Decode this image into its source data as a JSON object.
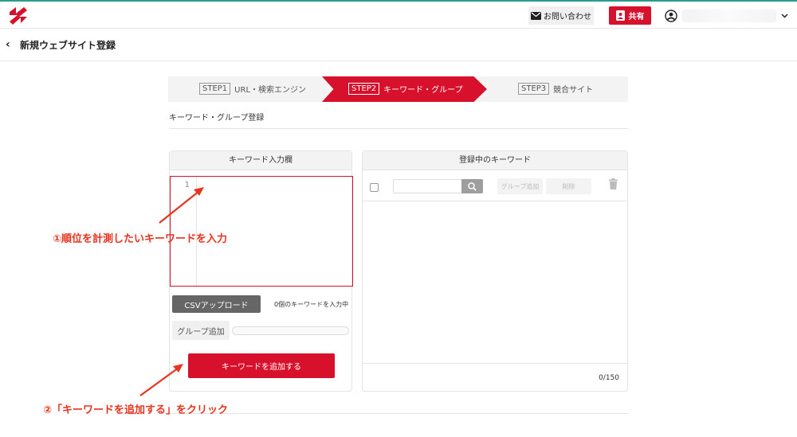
{
  "header": {
    "contact_label": "お問い合わせ",
    "share_label": "共有"
  },
  "page": {
    "back_icon": "chevron-left-icon",
    "title": "新規ウェブサイト登録"
  },
  "steps": [
    {
      "num": "STEP1",
      "label": "URL・検索エンジン",
      "active": false
    },
    {
      "num": "STEP2",
      "label": "キーワード・グループ",
      "active": true
    },
    {
      "num": "STEP3",
      "label": "競合サイト",
      "active": false
    }
  ],
  "section_title": "キーワード・グループ登録",
  "left_panel": {
    "title": "キーワード入力欄",
    "line_number": "1",
    "csv_label": "CSVアップロード",
    "count_text": "0個のキーワードを入力中",
    "group_label": "グループ追加",
    "add_label": "キーワードを追加する"
  },
  "right_panel": {
    "title": "登録中のキーワード",
    "group_add_label": "グループ追加",
    "delete_label": "削除",
    "counter": "0/150"
  },
  "annotations": {
    "first": "①順位を計測したいキーワードを入力",
    "second": "②「キーワードを追加する」をクリック"
  },
  "colors": {
    "brand_red": "#d7102c",
    "annotation_red": "#e8331f"
  }
}
